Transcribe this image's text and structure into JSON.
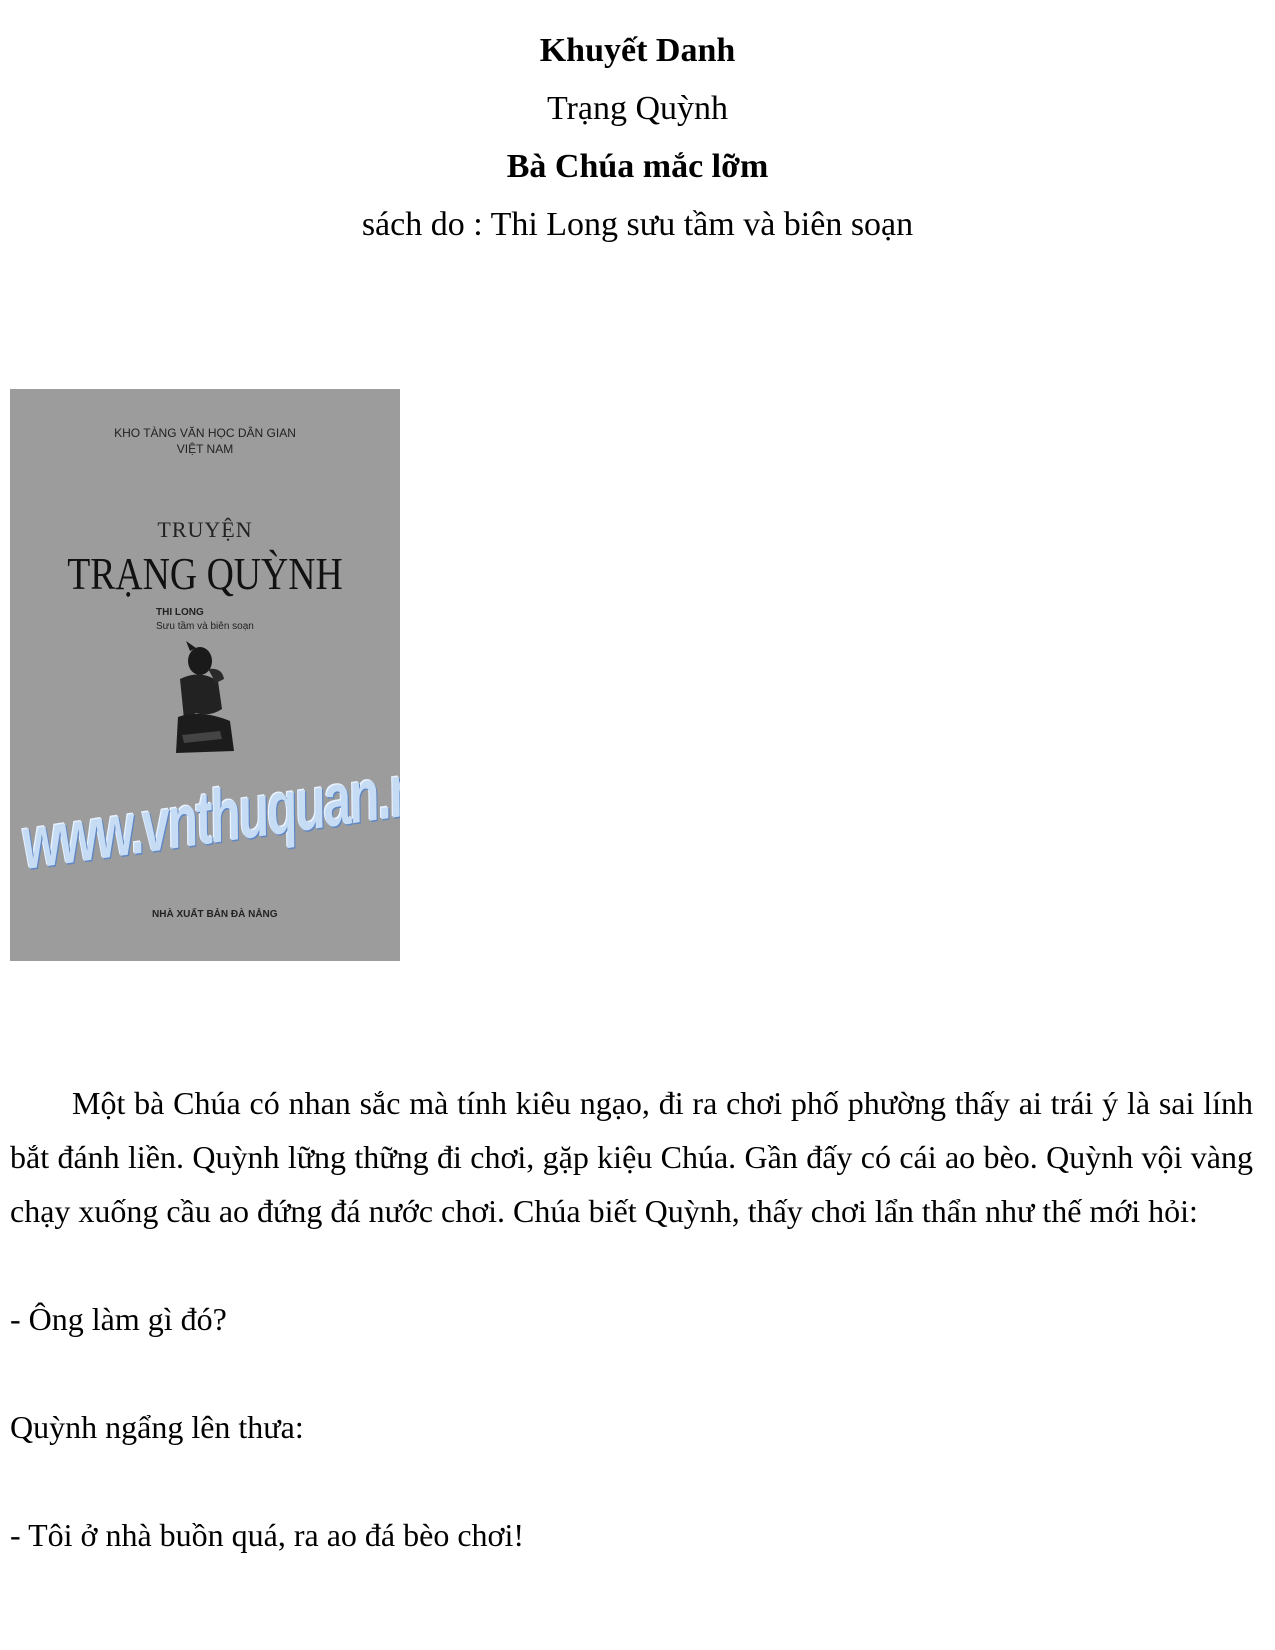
{
  "header": {
    "author": "Khuyết Danh",
    "book_title": "Trạng Quỳnh",
    "story_title": "Bà Chúa mắc lỡm",
    "source": "sách do : Thi Long sưu tầm và biên soạn"
  },
  "cover": {
    "series_line1": "KHO TÀNG VĂN HỌC DÂN GIAN",
    "series_line2": "VIỆT NAM",
    "truyen": "TRUYỆN",
    "title": "TRẠNG QUỲNH",
    "author": "THI LONG",
    "compiled": "Sưu tầm và biên soạn",
    "watermark": "www.vnthuquan.net",
    "publisher": "NHÀ XUẤT BẢN ĐÀ NẴNG",
    "background_color": "#9c9c9c"
  },
  "body": {
    "paragraph1": "Một bà Chúa có nhan sắc mà tính kiêu ngạo, đi ra chơi phố phường thấy ai trái ý là sai lính bắt đánh liền. Quỳnh lững thững đi chơi, gặp kiệu Chúa. Gần đấy có cái ao bèo. Quỳnh vội vàng chạy xuống cầu ao đứng đá nước chơi. Chúa biết Quỳnh, thấy chơi lẩn thẩn như thế mới hỏi:",
    "line2": "- Ông làm gì đó?",
    "line3": "Quỳnh ngẩng lên thưa:",
    "line4": "- Tôi ở nhà buồn quá, ra ao đá bèo chơi!"
  }
}
